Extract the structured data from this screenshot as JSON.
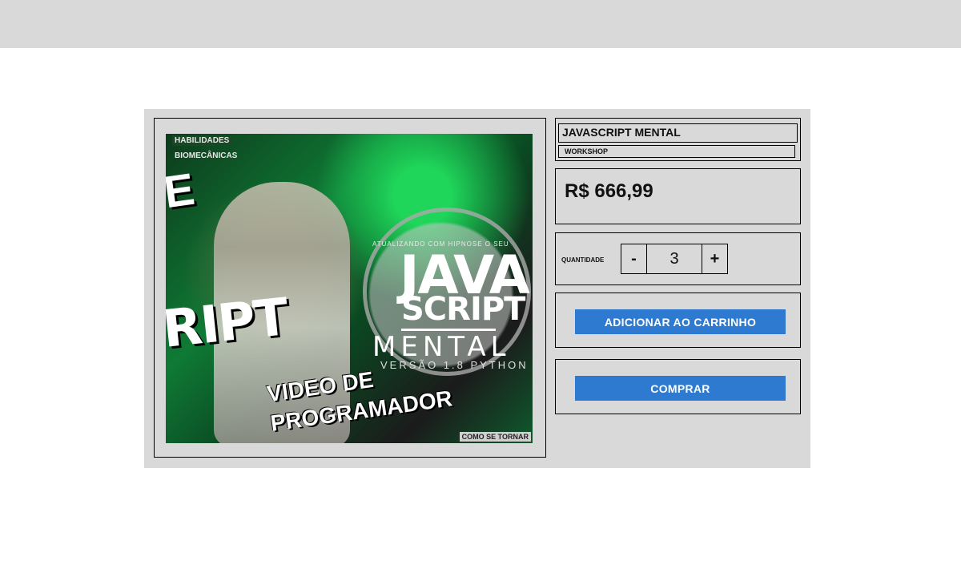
{
  "product": {
    "title": "JAVASCRIPT MENTAL",
    "category": "WORKSHOP",
    "price": "R$ 666,99",
    "image_alt": "JAVASCRIPT MENTAL workshop cover art",
    "image_text": {
      "habilidades": "HABILIDADES",
      "biomecanicas": "BIOMECÂNICAS",
      "atualizando": "ATUALIZANDO COM HIPNOSE O SEU",
      "java": "JAVA",
      "script": "SCRIPT",
      "mental": "MENTAL",
      "versao": "VERSÃO 1.8 PYTHON",
      "ript": "RIPT",
      "e": "E",
      "video": "VIDEO DE",
      "programador": "PROGRAMADOR",
      "como": "COMO SE TORNAR"
    }
  },
  "quantity": {
    "label": "QUANTIDADE",
    "value": "3",
    "minus": "-",
    "plus": "+"
  },
  "actions": {
    "add_to_cart": "ADICIONAR AO CARRINHO",
    "buy": "COMPRAR"
  },
  "colors": {
    "button": "#2e7ad0",
    "panel": "#d9d9d9",
    "header": "#d9d9d9"
  }
}
